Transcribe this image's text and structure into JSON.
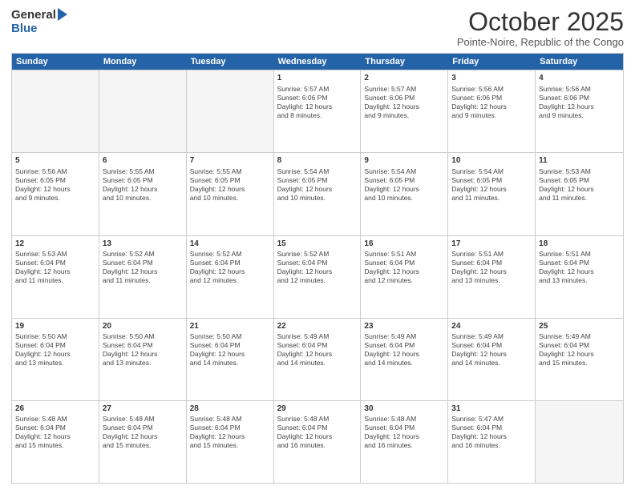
{
  "logo": {
    "general": "General",
    "blue": "Blue"
  },
  "header": {
    "month_title": "October 2025",
    "location": "Pointe-Noire, Republic of the Congo"
  },
  "days_of_week": [
    "Sunday",
    "Monday",
    "Tuesday",
    "Wednesday",
    "Thursday",
    "Friday",
    "Saturday"
  ],
  "weeks": [
    [
      {
        "day": "",
        "lines": [],
        "empty": true
      },
      {
        "day": "",
        "lines": [],
        "empty": true
      },
      {
        "day": "",
        "lines": [],
        "empty": true
      },
      {
        "day": "1",
        "lines": [
          "Sunrise: 5:57 AM",
          "Sunset: 6:06 PM",
          "Daylight: 12 hours",
          "and 8 minutes."
        ],
        "empty": false
      },
      {
        "day": "2",
        "lines": [
          "Sunrise: 5:57 AM",
          "Sunset: 6:06 PM",
          "Daylight: 12 hours",
          "and 9 minutes."
        ],
        "empty": false
      },
      {
        "day": "3",
        "lines": [
          "Sunrise: 5:56 AM",
          "Sunset: 6:06 PM",
          "Daylight: 12 hours",
          "and 9 minutes."
        ],
        "empty": false
      },
      {
        "day": "4",
        "lines": [
          "Sunrise: 5:56 AM",
          "Sunset: 6:06 PM",
          "Daylight: 12 hours",
          "and 9 minutes."
        ],
        "empty": false
      }
    ],
    [
      {
        "day": "5",
        "lines": [
          "Sunrise: 5:56 AM",
          "Sunset: 6:05 PM",
          "Daylight: 12 hours",
          "and 9 minutes."
        ],
        "empty": false
      },
      {
        "day": "6",
        "lines": [
          "Sunrise: 5:55 AM",
          "Sunset: 6:05 PM",
          "Daylight: 12 hours",
          "and 10 minutes."
        ],
        "empty": false
      },
      {
        "day": "7",
        "lines": [
          "Sunrise: 5:55 AM",
          "Sunset: 6:05 PM",
          "Daylight: 12 hours",
          "and 10 minutes."
        ],
        "empty": false
      },
      {
        "day": "8",
        "lines": [
          "Sunrise: 5:54 AM",
          "Sunset: 6:05 PM",
          "Daylight: 12 hours",
          "and 10 minutes."
        ],
        "empty": false
      },
      {
        "day": "9",
        "lines": [
          "Sunrise: 5:54 AM",
          "Sunset: 6:05 PM",
          "Daylight: 12 hours",
          "and 10 minutes."
        ],
        "empty": false
      },
      {
        "day": "10",
        "lines": [
          "Sunrise: 5:54 AM",
          "Sunset: 6:05 PM",
          "Daylight: 12 hours",
          "and 11 minutes."
        ],
        "empty": false
      },
      {
        "day": "11",
        "lines": [
          "Sunrise: 5:53 AM",
          "Sunset: 6:05 PM",
          "Daylight: 12 hours",
          "and 11 minutes."
        ],
        "empty": false
      }
    ],
    [
      {
        "day": "12",
        "lines": [
          "Sunrise: 5:53 AM",
          "Sunset: 6:04 PM",
          "Daylight: 12 hours",
          "and 11 minutes."
        ],
        "empty": false
      },
      {
        "day": "13",
        "lines": [
          "Sunrise: 5:52 AM",
          "Sunset: 6:04 PM",
          "Daylight: 12 hours",
          "and 11 minutes."
        ],
        "empty": false
      },
      {
        "day": "14",
        "lines": [
          "Sunrise: 5:52 AM",
          "Sunset: 6:04 PM",
          "Daylight: 12 hours",
          "and 12 minutes."
        ],
        "empty": false
      },
      {
        "day": "15",
        "lines": [
          "Sunrise: 5:52 AM",
          "Sunset: 6:04 PM",
          "Daylight: 12 hours",
          "and 12 minutes."
        ],
        "empty": false
      },
      {
        "day": "16",
        "lines": [
          "Sunrise: 5:51 AM",
          "Sunset: 6:04 PM",
          "Daylight: 12 hours",
          "and 12 minutes."
        ],
        "empty": false
      },
      {
        "day": "17",
        "lines": [
          "Sunrise: 5:51 AM",
          "Sunset: 6:04 PM",
          "Daylight: 12 hours",
          "and 13 minutes."
        ],
        "empty": false
      },
      {
        "day": "18",
        "lines": [
          "Sunrise: 5:51 AM",
          "Sunset: 6:04 PM",
          "Daylight: 12 hours",
          "and 13 minutes."
        ],
        "empty": false
      }
    ],
    [
      {
        "day": "19",
        "lines": [
          "Sunrise: 5:50 AM",
          "Sunset: 6:04 PM",
          "Daylight: 12 hours",
          "and 13 minutes."
        ],
        "empty": false
      },
      {
        "day": "20",
        "lines": [
          "Sunrise: 5:50 AM",
          "Sunset: 6:04 PM",
          "Daylight: 12 hours",
          "and 13 minutes."
        ],
        "empty": false
      },
      {
        "day": "21",
        "lines": [
          "Sunrise: 5:50 AM",
          "Sunset: 6:04 PM",
          "Daylight: 12 hours",
          "and 14 minutes."
        ],
        "empty": false
      },
      {
        "day": "22",
        "lines": [
          "Sunrise: 5:49 AM",
          "Sunset: 6:04 PM",
          "Daylight: 12 hours",
          "and 14 minutes."
        ],
        "empty": false
      },
      {
        "day": "23",
        "lines": [
          "Sunrise: 5:49 AM",
          "Sunset: 6:04 PM",
          "Daylight: 12 hours",
          "and 14 minutes."
        ],
        "empty": false
      },
      {
        "day": "24",
        "lines": [
          "Sunrise: 5:49 AM",
          "Sunset: 6:04 PM",
          "Daylight: 12 hours",
          "and 14 minutes."
        ],
        "empty": false
      },
      {
        "day": "25",
        "lines": [
          "Sunrise: 5:49 AM",
          "Sunset: 6:04 PM",
          "Daylight: 12 hours",
          "and 15 minutes."
        ],
        "empty": false
      }
    ],
    [
      {
        "day": "26",
        "lines": [
          "Sunrise: 5:48 AM",
          "Sunset: 6:04 PM",
          "Daylight: 12 hours",
          "and 15 minutes."
        ],
        "empty": false
      },
      {
        "day": "27",
        "lines": [
          "Sunrise: 5:48 AM",
          "Sunset: 6:04 PM",
          "Daylight: 12 hours",
          "and 15 minutes."
        ],
        "empty": false
      },
      {
        "day": "28",
        "lines": [
          "Sunrise: 5:48 AM",
          "Sunset: 6:04 PM",
          "Daylight: 12 hours",
          "and 15 minutes."
        ],
        "empty": false
      },
      {
        "day": "29",
        "lines": [
          "Sunrise: 5:48 AM",
          "Sunset: 6:04 PM",
          "Daylight: 12 hours",
          "and 16 minutes."
        ],
        "empty": false
      },
      {
        "day": "30",
        "lines": [
          "Sunrise: 5:48 AM",
          "Sunset: 6:04 PM",
          "Daylight: 12 hours",
          "and 16 minutes."
        ],
        "empty": false
      },
      {
        "day": "31",
        "lines": [
          "Sunrise: 5:47 AM",
          "Sunset: 6:04 PM",
          "Daylight: 12 hours",
          "and 16 minutes."
        ],
        "empty": false
      },
      {
        "day": "",
        "lines": [],
        "empty": true
      }
    ]
  ]
}
